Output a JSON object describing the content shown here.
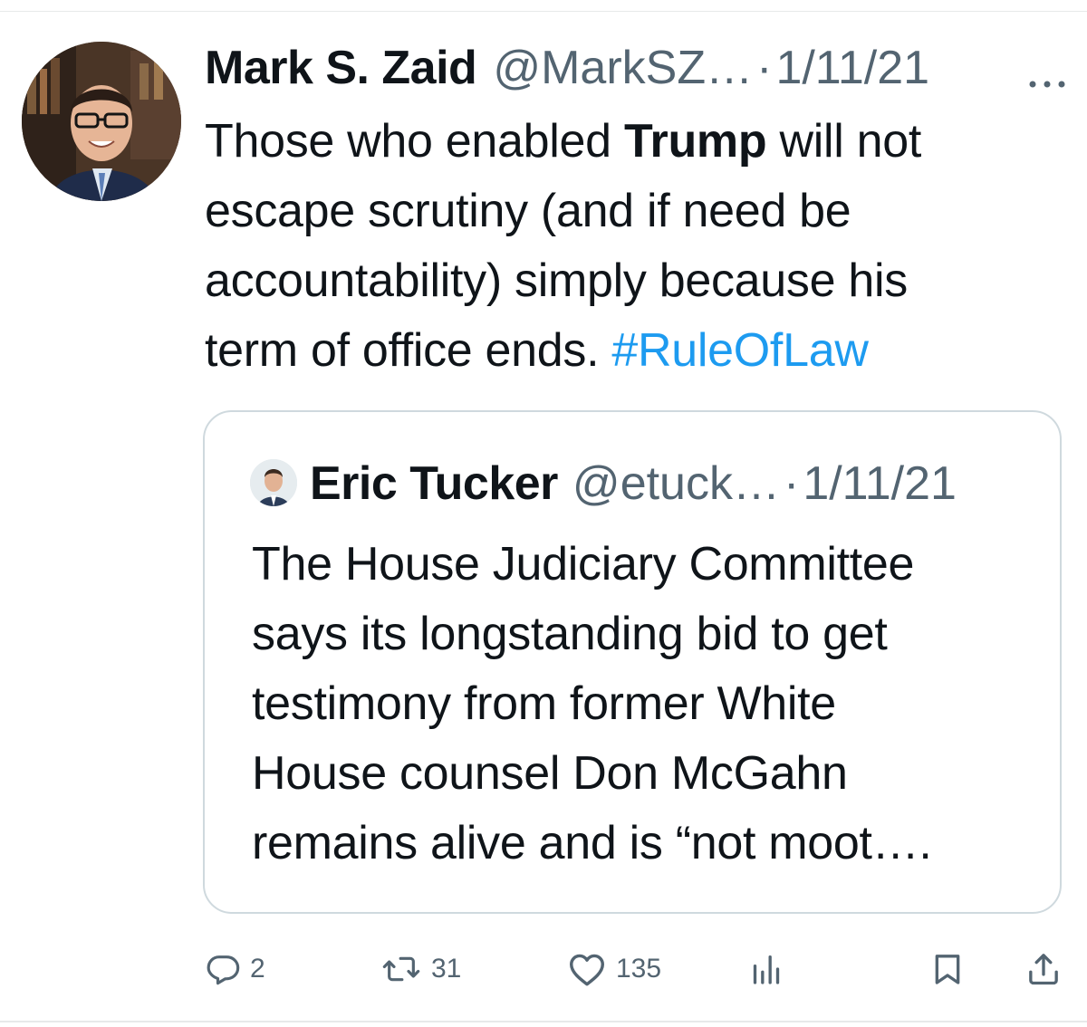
{
  "tweet": {
    "author": {
      "display_name": "Mark S. Zaid",
      "handle": "@MarkSZ…",
      "separator": "·",
      "date": "1/11/21"
    },
    "text_lines": [
      {
        "before": "Those who enabled ",
        "bold": "Trump",
        "after": " will not"
      },
      {
        "text": "escape scrutiny (and if need be"
      },
      {
        "text": "accountability) simply because his"
      },
      {
        "text": "term of office ends. ",
        "hashtag": "#RuleOfLaw"
      }
    ]
  },
  "quoted_tweet": {
    "author": {
      "display_name": "Eric Tucker",
      "handle": "@etuck…",
      "separator": "·",
      "date": "1/11/21"
    },
    "text_lines": [
      "The House Judiciary Committee",
      "says its longstanding bid to get",
      "testimony from former White",
      "House counsel Don McGahn",
      "remains alive and is “not moot…."
    ]
  },
  "actions": {
    "replies": "2",
    "retweets": "31",
    "likes": "135"
  },
  "icons": {
    "more": "more-dots-icon",
    "reply": "reply-icon",
    "retweet": "retweet-icon",
    "like": "heart-icon",
    "views": "analytics-icon",
    "bookmark": "bookmark-icon",
    "share": "share-icon"
  },
  "colors": {
    "text": "#0f1419",
    "secondary": "#536471",
    "link": "#1d9bf0",
    "border": "#cfd9de"
  }
}
